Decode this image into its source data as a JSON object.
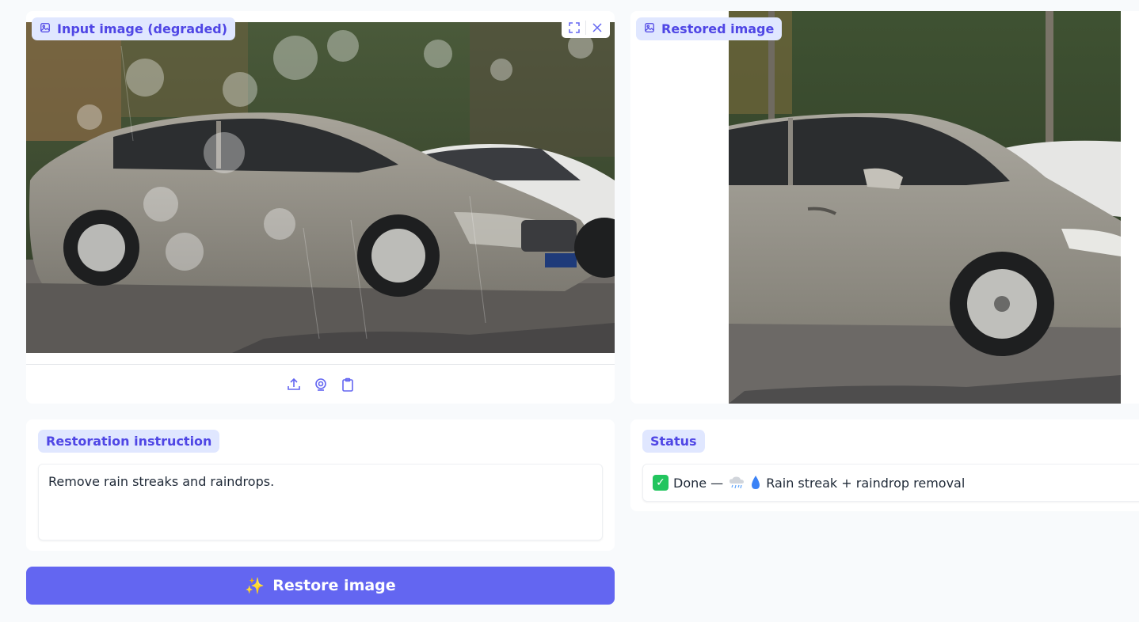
{
  "input_panel": {
    "label": "Input image (degraded)",
    "icons": [
      "image-icon",
      "fullscreen-icon",
      "close-icon",
      "upload-icon",
      "webcam-icon",
      "clipboard-icon"
    ]
  },
  "output_panel": {
    "label": "Restored image",
    "icons": [
      "image-icon"
    ]
  },
  "instruction": {
    "label": "Restoration instruction",
    "value": "Remove rain streaks and raindrops."
  },
  "status": {
    "label": "Status",
    "done_text": "Done —",
    "task_text": "Rain streak + raindrop removal",
    "icons": [
      "check-icon",
      "rain-cloud-icon",
      "droplet-icon"
    ]
  },
  "action": {
    "restore_label": "Restore image",
    "icon": "sparkles-icon"
  },
  "colors": {
    "accent": "#6366f1",
    "chip_bg": "#e0e7ff",
    "chip_text": "#4f46e5",
    "success": "#22c55e"
  }
}
